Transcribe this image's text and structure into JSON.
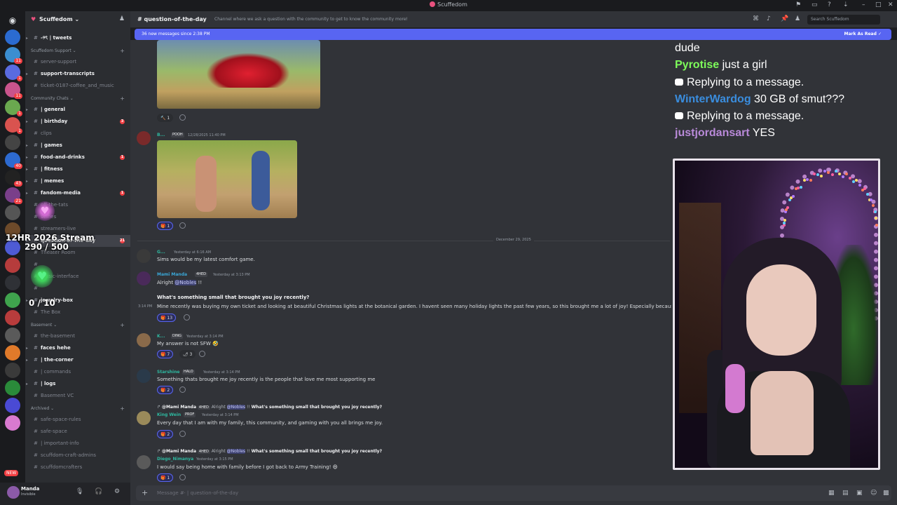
{
  "window": {
    "title": "Scuffedom"
  },
  "server": {
    "name": "Scuffedom"
  },
  "rail": {
    "servers": [
      {
        "color": "#2b6bd1",
        "badge": ""
      },
      {
        "color": "#3b8ed1",
        "badge": "11"
      },
      {
        "color": "#5a6be0",
        "badge": "1"
      },
      {
        "color": "#c9548c",
        "badge": "11"
      },
      {
        "color": "#6aa84f",
        "badge": "1"
      },
      {
        "color": "#d9534f",
        "badge": "1"
      },
      {
        "color": "#444",
        "badge": ""
      },
      {
        "color": "#2d6ad0",
        "badge": "40"
      },
      {
        "color": "#222",
        "badge": "43"
      },
      {
        "color": "#7a3f8a",
        "badge": "21"
      },
      {
        "color": "#555",
        "badge": ""
      },
      {
        "color": "#6d4a2a",
        "badge": ""
      },
      {
        "color": "#4e5bd4",
        "badge": ""
      },
      {
        "color": "#b63c3c",
        "badge": ""
      },
      {
        "color": "#2f3136",
        "badge": ""
      },
      {
        "color": "#3fa34d",
        "badge": ""
      },
      {
        "color": "#b83c3c",
        "badge": ""
      },
      {
        "color": "#5a5a5a",
        "badge": ""
      },
      {
        "color": "#e07a2a",
        "badge": ""
      },
      {
        "color": "#3a3a3a",
        "badge": ""
      },
      {
        "color": "#2a8a3a",
        "badge": ""
      },
      {
        "color": "#4a4ad4",
        "badge": ""
      },
      {
        "color": "#d97ad0",
        "badge": ""
      }
    ],
    "new_badge": "NEW"
  },
  "channels": [
    {
      "type": "channel",
      "label": "-୨ৎ | tweets",
      "unread": true
    },
    {
      "type": "category",
      "label": "Scuffedom Support ⌄"
    },
    {
      "type": "channel",
      "label": "server-support",
      "unread": false
    },
    {
      "type": "channel",
      "label": "support-transcripts",
      "unread": true
    },
    {
      "type": "channel",
      "label": "ticket-0187-coffee_and_music",
      "unread": false
    },
    {
      "type": "category",
      "label": "Community Chats ⌄"
    },
    {
      "type": "channel",
      "label": "| general",
      "unread": true
    },
    {
      "type": "channel",
      "label": "| birthday",
      "unread": true,
      "badge": "3"
    },
    {
      "type": "channel",
      "label": "clips",
      "unread": false
    },
    {
      "type": "channel",
      "label": "| games",
      "unread": true
    },
    {
      "type": "channel",
      "label": "food-and-drinks",
      "unread": true,
      "badge": "1"
    },
    {
      "type": "channel",
      "label": "| fitness",
      "unread": true
    },
    {
      "type": "channel",
      "label": "| memes",
      "unread": true
    },
    {
      "type": "channel",
      "label": "fandom-media",
      "unread": true,
      "badge": "1"
    },
    {
      "type": "channel",
      "label": "off-the-tats",
      "unread": false
    },
    {
      "type": "channel",
      "label": "selfies",
      "unread": false
    },
    {
      "type": "channel",
      "label": "streamers-live",
      "unread": false
    },
    {
      "type": "channel",
      "label": "question-of-the-day",
      "unread": true,
      "active": true,
      "badge": "21"
    },
    {
      "type": "channel",
      "label": "Theater Room",
      "unread": false
    },
    {
      "type": "channel",
      "label": "",
      "unread": false
    },
    {
      "type": "channel",
      "label": "music-interface",
      "unread": false
    },
    {
      "type": "channel",
      "label": "",
      "unread": false
    },
    {
      "type": "channel",
      "label": "jewelry-box",
      "unread": true
    },
    {
      "type": "channel",
      "label": "The Box",
      "unread": false
    },
    {
      "type": "category",
      "label": "Basement ⌄"
    },
    {
      "type": "channel",
      "label": "the-basement",
      "unread": false
    },
    {
      "type": "channel",
      "label": "faces hehe",
      "unread": true
    },
    {
      "type": "channel",
      "label": "| the-corner",
      "unread": true
    },
    {
      "type": "channel",
      "label": "| commands",
      "unread": false
    },
    {
      "type": "channel",
      "label": "| logs",
      "unread": true
    },
    {
      "type": "channel",
      "label": "Basement VC",
      "unread": false
    },
    {
      "type": "category",
      "label": "Archived ⌄"
    },
    {
      "type": "channel",
      "label": "safe-space-rules",
      "unread": false
    },
    {
      "type": "channel",
      "label": "safe-space",
      "unread": false
    },
    {
      "type": "channel",
      "label": "| important-info",
      "unread": false
    },
    {
      "type": "channel",
      "label": "scuffdom-craft-admins",
      "unread": false
    },
    {
      "type": "channel",
      "label": "scuffdomcrafters",
      "unread": false
    }
  ],
  "user": {
    "name": "Manda",
    "status": "Invisible"
  },
  "overlay": {
    "goal_title": "12HR 2026 Stream",
    "goal_progress": "290 / 500",
    "sub_count": "0 / 10"
  },
  "header": {
    "channel_name": "question-of-the-day",
    "topic": "Channel where we ask a question with the community to get to know the community more!",
    "search_placeholder": "Search Scuffedom"
  },
  "newbar": {
    "text": "36 new messages since 2:38 PM",
    "action": "Mark As Read"
  },
  "messages": {
    "reactions_top": [
      {
        "count": "1"
      }
    ],
    "m_pooh": {
      "name": "B...",
      "tag": "POOH",
      "time": "12/28/2025 11:40 PM"
    },
    "reactions_pooh": [
      {
        "count": "1"
      }
    ],
    "date_divider": "December 29, 2025",
    "m_g": {
      "name": "G...",
      "time": "Yesterday at 6:16 AM",
      "text": "Sims would be my latest comfort game."
    },
    "m_manda": {
      "name": "Mami Manda",
      "tag": "4HED",
      "time": "Yesterday at 3:13 PM",
      "text_pre": "Alright ",
      "mention": "@Nobles",
      "text_post": " !!"
    },
    "m_manda_q": "What's something small that brought you joy recently?",
    "m_manda_ts": "3:14 PM",
    "m_manda_2": "Mine recently was buying my own ticket and looking at beautiful Christmas lights at the botanical garden. I havent seen many holiday lights the past few years, so this brought me a lot of joy! Especially because I shared",
    "reactions_manda": [
      {
        "count": "13"
      }
    ],
    "m_k": {
      "name": "K...",
      "tag": "DING",
      "time": "Yesterday at 3:14 PM",
      "text": "My answer is not SFW 🤣"
    },
    "reactions_k": [
      {
        "count": "7"
      },
      {
        "count": "3"
      }
    ],
    "m_star": {
      "name": "Starshine",
      "tag": "HALO",
      "time": "Yesterday at 3:14 PM",
      "text": "Something thats brought me joy recently is the people that love me most supporting me"
    },
    "reactions_star": [
      {
        "count": "2"
      }
    ],
    "reply1": {
      "name": "@Mami Manda",
      "tag": "4HED",
      "pre": "Alright ",
      "mention": "@Nobles",
      "post": " !!",
      "q": "What's something small that brought you joy recently?"
    },
    "m_king": {
      "name": "King Wein",
      "tag": "PROF",
      "time": "Yesterday at 3:14 PM",
      "text": "Every day that I am with my family, this community, and gaming with you all brings me joy."
    },
    "reactions_king": [
      {
        "count": "2"
      }
    ],
    "reply2": {
      "name": "@Mami Manda",
      "tag": "4HED",
      "pre": "Alright ",
      "mention": "@Nobles",
      "post": " !!",
      "q": "What's something small that brought you joy recently?"
    },
    "m_diego": {
      "name": "Diego_Nimanya",
      "time": "Yesterday at 3:15 PM",
      "text": "I would say being home with family before I got back to Army Training! 😄"
    },
    "reactions_diego": [
      {
        "count": "1"
      }
    ]
  },
  "input": {
    "placeholder": "Message #⸱ | question-of-the-day"
  },
  "stream_chat": [
    {
      "user": "",
      "user_color": "#ffffff",
      "text": "dude",
      "reply": false
    },
    {
      "user": "Pyrotise",
      "user_color": "#7dfc5a",
      "text": " just a girl",
      "reply": false
    },
    {
      "user": "",
      "user_color": "#ffffff",
      "text": "Replying to a message.",
      "reply": true
    },
    {
      "user": "WinterWardog",
      "user_color": "#3a8dde",
      "text": " 30 GB of smut???",
      "reply": false
    },
    {
      "user": "",
      "user_color": "#ffffff",
      "text": "Replying to a message.",
      "reply": true
    },
    {
      "user": "justjordansart",
      "user_color": "#b98ad9",
      "text": " YES",
      "reply": false
    }
  ],
  "colors": {
    "accent": "#5865f2",
    "pyrotise": "#7dfc5a",
    "winterwardog": "#3a8dde",
    "justjordansart": "#b98ad9",
    "mention_badge": "#f23f43"
  }
}
